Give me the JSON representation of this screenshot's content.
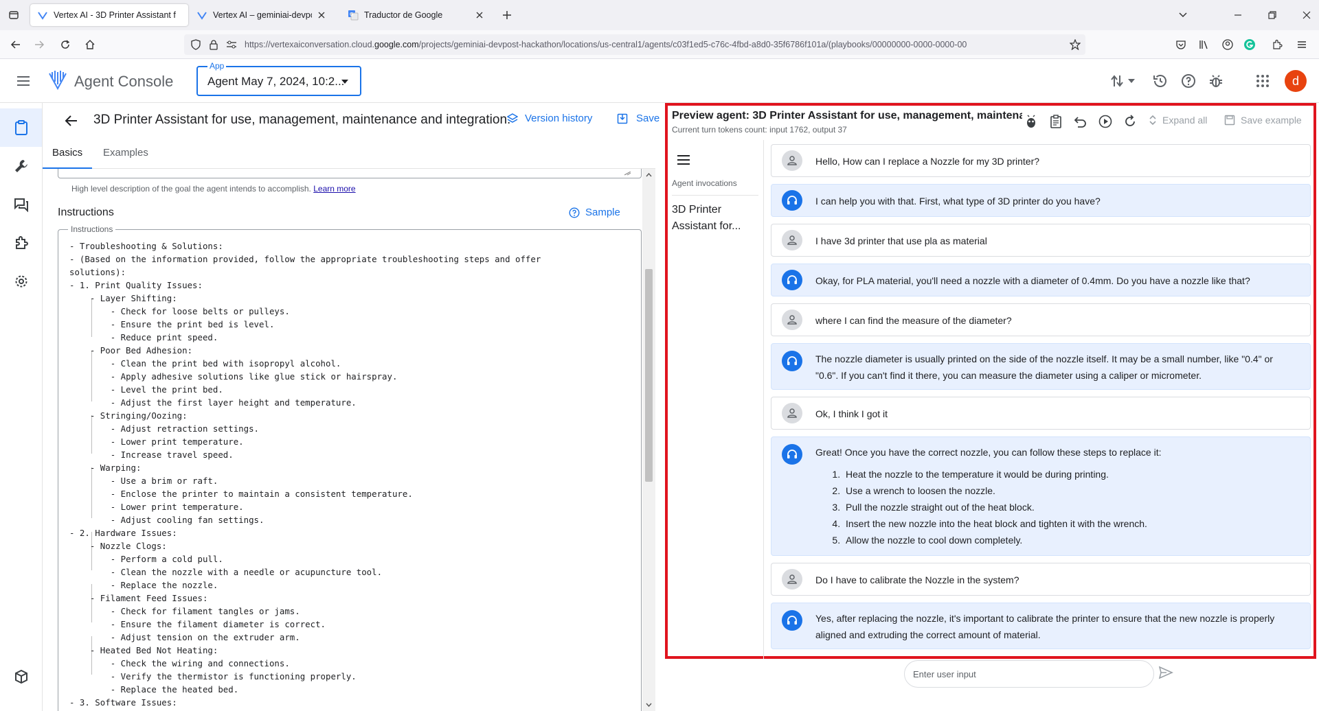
{
  "browser": {
    "tabs": [
      {
        "title": "Vertex AI - 3D Printer Assistant f",
        "active": true
      },
      {
        "title": "Vertex AI – geminiai-devpost-h",
        "active": false
      },
      {
        "title": "Traductor de Google",
        "active": false
      }
    ],
    "url_prefix": "https://vertexaiconversation.cloud.",
    "url_domain": "google.com",
    "url_rest": "/projects/geminiai-devpost-hackathon/locations/us-central1/agents/c03f1ed5-c76c-4fbd-a8d0-35f6786f101a/(playbooks/00000000-0000-0000-00"
  },
  "header": {
    "product": "Agent Console",
    "app_label": "App",
    "app_value": "Agent May 7, 2024, 10:2...",
    "avatar_letter": "d"
  },
  "editor": {
    "title": "3D Printer Assistant for use, management, maintenance and integration.",
    "version_history": "Version history",
    "save": "Save",
    "tabs": [
      "Basics",
      "Examples"
    ],
    "hint": "High level description of the goal the agent intends to accomplish.",
    "learn_more": "Learn more",
    "instructions_heading": "Instructions",
    "sample": "Sample",
    "instructions_legend": "Instructions",
    "instructions_text": "- Troubleshooting & Solutions:\n- (Based on the information provided, follow the appropriate troubleshooting steps and offer\nsolutions):\n- 1. Print Quality Issues:\n    - Layer Shifting:\n        - Check for loose belts or pulleys.\n        - Ensure the print bed is level.\n        - Reduce print speed.\n    - Poor Bed Adhesion:\n        - Clean the print bed with isopropyl alcohol.\n        - Apply adhesive solutions like glue stick or hairspray.\n        - Level the print bed.\n        - Adjust the first layer height and temperature.\n    - Stringing/Oozing:\n        - Adjust retraction settings.\n        - Lower print temperature.\n        - Increase travel speed.\n    - Warping:\n        - Use a brim or raft.\n        - Enclose the printer to maintain a consistent temperature.\n        - Lower print temperature.\n        - Adjust cooling fan settings.\n- 2. Hardware Issues:\n    - Nozzle Clogs:\n        - Perform a cold pull.\n        - Clean the nozzle with a needle or acupuncture tool.\n        - Replace the nozzle.\n    - Filament Feed Issues:\n        - Check for filament tangles or jams.\n        - Ensure the filament diameter is correct.\n        - Adjust tension on the extruder arm.\n    - Heated Bed Not Heating:\n        - Check the wiring and connections.\n        - Verify the thermistor is functioning properly.\n        - Replace the heated bed.\n- 3. Software Issues:"
  },
  "preview": {
    "title": "Preview agent: 3D Printer Assistant for use, management, maintena",
    "tokens": "Current turn tokens count: input 1762, output 37",
    "expand_all": "Expand all",
    "save_example": "Save example",
    "invocations_label": "Agent invocations",
    "invocation_item": "3D Printer Assistant for...",
    "messages": [
      {
        "role": "user",
        "text": "Hello, How can I replace a Nozzle for my 3D printer?"
      },
      {
        "role": "agent",
        "text": "I can help you with that. First, what type of 3D printer do you have?"
      },
      {
        "role": "user",
        "text": "I have 3d printer that use pla as material"
      },
      {
        "role": "agent",
        "text": "Okay, for PLA material, you'll need a nozzle with a diameter of 0.4mm. Do you have a nozzle like that?"
      },
      {
        "role": "user",
        "text": "where I can find the measure of the diameter?"
      },
      {
        "role": "agent",
        "text": "The nozzle diameter is usually printed on the side of the nozzle itself. It may be a small number, like \"0.4\" or \"0.6\". If you can't find it there, you can measure the diameter using a caliper or micrometer."
      },
      {
        "role": "user",
        "text": "Ok, I think I got it"
      },
      {
        "role": "agent",
        "text": "Great! Once you have the correct nozzle, you can follow these steps to replace it:",
        "steps": [
          "Heat the nozzle to the temperature it would be during printing.",
          "Use a wrench to loosen the nozzle.",
          "Pull the nozzle straight out of the heat block.",
          "Insert the new nozzle into the heat block and tighten it with the wrench.",
          "Allow the nozzle to cool down completely."
        ]
      },
      {
        "role": "user",
        "text": "Do I have to calibrate the Nozzle in the system?"
      },
      {
        "role": "agent",
        "text": "Yes, after replacing the nozzle, it's important to calibrate the printer to ensure that the new nozzle is properly aligned and extruding the correct amount of material."
      }
    ],
    "input_placeholder": "Enter user input"
  },
  "colors": {
    "accent": "#1a73e8",
    "highlight_border": "#e0141e",
    "avatar": "#e8430f"
  }
}
